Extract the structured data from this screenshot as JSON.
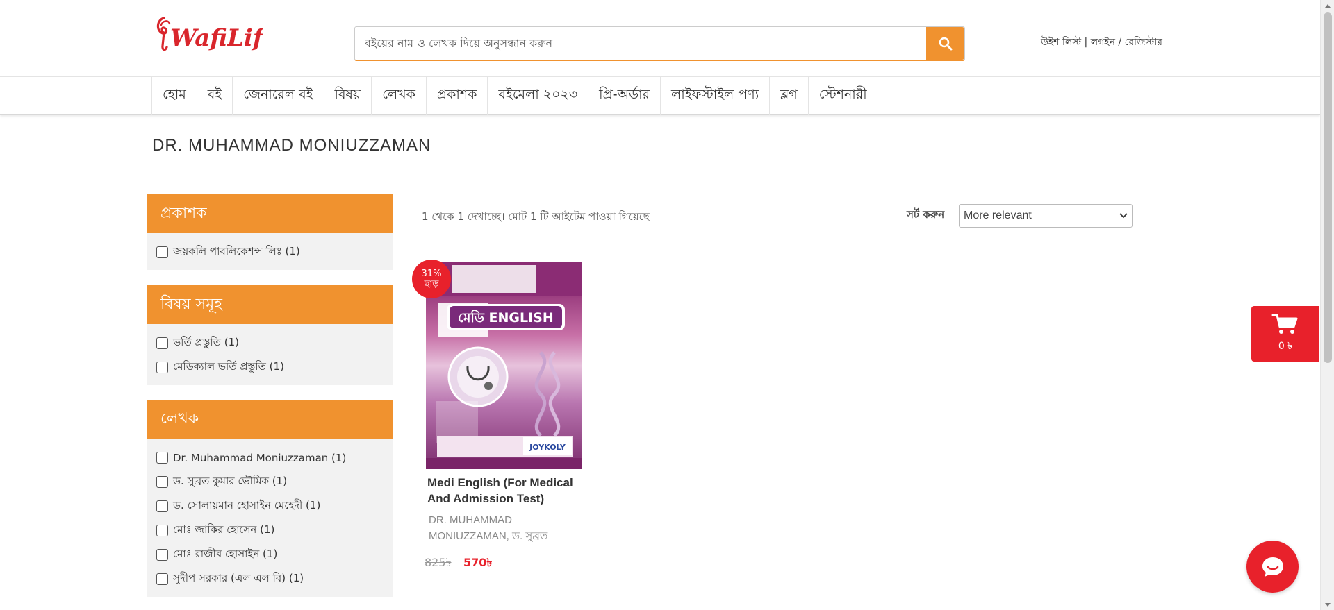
{
  "brand": {
    "logo_text": "WafiLife",
    "accent": "#f0922f",
    "red": "#e8212b"
  },
  "search": {
    "placeholder": "বইয়ের নাম ও লেখক দিয়ে অনুসন্ধান করুন",
    "icon": "search-icon"
  },
  "header_links": {
    "wishlist": "উইশ লিস্ট",
    "sep1": " | ",
    "login": "লগইন",
    "sep2": " / ",
    "register": "রেজিস্টার"
  },
  "nav": {
    "items": [
      "হোম",
      "বই",
      "জেনারেল বই",
      "বিষয়",
      "লেখক",
      "প্রকাশক",
      "বইমেলা ২০২৩",
      "প্রি-অর্ডার",
      "লাইফস্টাইল পণ্য",
      "ব্লগ",
      "স্টেশনারী"
    ]
  },
  "page_title": "DR. MUHAMMAD MONIUZZAMAN",
  "filters": [
    {
      "title": "প্রকাশক",
      "options": [
        "জয়কলি পাবলিকেশন্স লিঃ (1)"
      ]
    },
    {
      "title": "বিষয় সমূহ",
      "options": [
        "ভর্তি প্রস্তুতি (1)",
        "মেডিক্যাল ভর্তি প্রস্তুতি (1)"
      ]
    },
    {
      "title": "লেখক",
      "options": [
        " Dr. Muhammad Moniuzzaman (1)",
        "ড. সুব্রত কুমার ভৌমিক (1)",
        "ড. সোলায়মান হোসাইন মেহেদী (1)",
        "মোঃ জাকির হোসেন (1)",
        "মোঃ রাজীব হোসাইন (1)",
        "সুদীপ সরকার (এল এল বি) (1)"
      ]
    }
  ],
  "results": {
    "count_text": "1 থেকে 1 দেখাচ্ছে। মোট 1 টি আইটেম পাওয়া গিয়েছে",
    "sort_label": "সর্ট করুন",
    "sort_value": "More relevant"
  },
  "product": {
    "discount_line1": "31%",
    "discount_line2": "ছাড়",
    "cover_title": "মেডি ENGLISH",
    "cover_publisher": "JOYKOLY",
    "title": "Medi English (For Medical And Admission Test)",
    "authors": " DR. MUHAMMAD MONIUZZAMAN, ড. সুব্রত",
    "price_old": "825৳",
    "price_new": "570৳"
  },
  "cart": {
    "amount": "0 ৳",
    "icon": "cart-icon"
  },
  "chat": {
    "icon": "chat-icon"
  }
}
